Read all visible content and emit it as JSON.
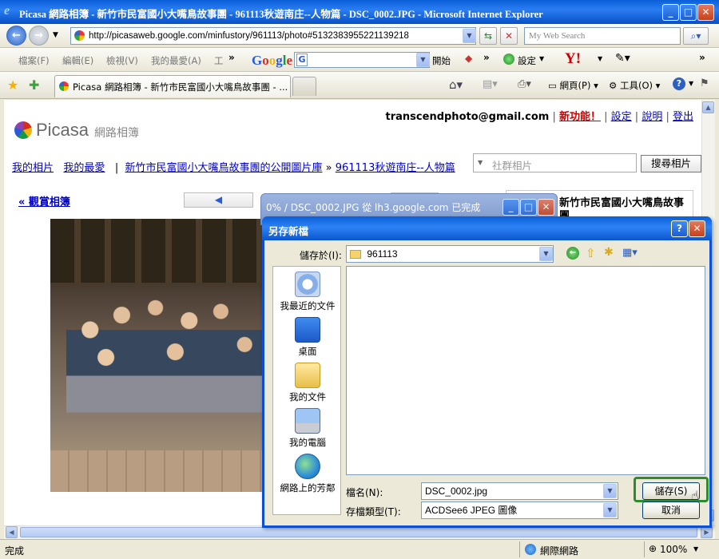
{
  "browser": {
    "window_title": "Picasa 網路相簿 - 新竹市民富國小大嘴鳥故事團 - 961113秋遊南庄--人物篇 - DSC_0002.JPG - Microsoft Internet Explorer",
    "address": "http://picasaweb.google.com/minfustory/961113/photo#5132383955221139218",
    "search_placeholder": "My Web Search",
    "menu": [
      "檔案(F)",
      "編輯(E)",
      "檢視(V)",
      "我的最愛(A)",
      "工"
    ],
    "google_label": "Google",
    "google_start": "開始",
    "google_settings": "設定",
    "tab_title": "Picasa 網路相簿 - 新竹市民富國小大嘴鳥故事團 - ...",
    "cmd_page": "網頁(P)",
    "cmd_tools": "工具(O)",
    "status_text": "完成",
    "zone": "網際網路",
    "zoom": "100%"
  },
  "page": {
    "user_email": "transcendphoto@gmail.com",
    "links": {
      "new_features": "新功能！",
      "settings": "設定",
      "help": "說明",
      "logout": "登出"
    },
    "logo_text": "Picasa",
    "logo_sub": "網路相簿",
    "breadcrumb": {
      "my_photos": "我的相片",
      "favorites": "我的最愛",
      "gallery": "新竹市民富國小大嘴鳥故事團的公開圖片庫",
      "album": "961113秋遊南庄--人物篇"
    },
    "community_search_placeholder": "社群相片",
    "search_button": "搜尋相片",
    "back_to_album": "« 觀賞相簿",
    "side_title": "新竹市民富國小大嘴鳥故事團"
  },
  "download_dialog": {
    "title": "0% / DSC_0002.JPG 從 lh3.google.com 已完成"
  },
  "save_dialog": {
    "title": "另存新檔",
    "save_in_label": "儲存於(I):",
    "save_in_value": "961113",
    "places": [
      "我最近的文件",
      "桌面",
      "我的文件",
      "我的電腦",
      "網路上的芳鄰"
    ],
    "filename_label": "檔名(N):",
    "filename_value": "DSC_0002.jpg",
    "filetype_label": "存檔類型(T):",
    "filetype_value": "ACDSee6 JPEG 圖像",
    "save_button": "儲存(S)",
    "cancel_button": "取消"
  }
}
